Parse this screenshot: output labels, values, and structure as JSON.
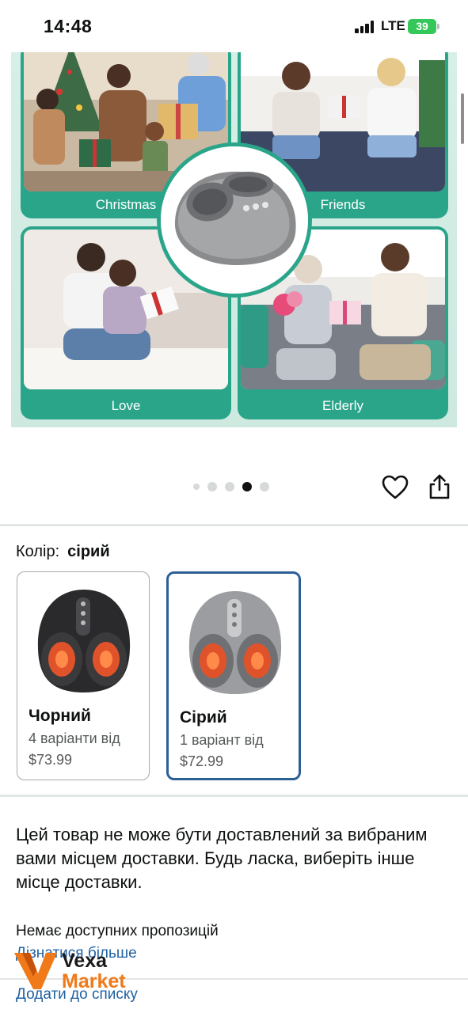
{
  "status_bar": {
    "time": "14:48",
    "network": "LTE",
    "battery": "39"
  },
  "gallery": {
    "tiles": [
      {
        "label": "Christmas"
      },
      {
        "label": "Friends"
      },
      {
        "label": "Love"
      },
      {
        "label": "Elderly"
      }
    ],
    "pagination": {
      "count": 5,
      "active_index": 3
    }
  },
  "actions": {
    "favorite_icon": "heart-icon",
    "share_icon": "share-icon"
  },
  "color_selector": {
    "label": "Колір:",
    "selected_value": "сірий",
    "options": [
      {
        "name": "Чорний",
        "variants": "4 варіанти від",
        "price": "$73.99",
        "selected": false
      },
      {
        "name": "Сірий",
        "variants": "1 варіант від",
        "price": "$72.99",
        "selected": true
      }
    ]
  },
  "delivery": {
    "message": "Цей товар не може бути доставлений за вибраним вами місцем доставки. Будь ласка, виберіть інше місце доставки.",
    "no_offers": "Немає доступних пропозицій",
    "learn_more": "Дізнатися більше",
    "add_to_list": "Додати до списку"
  },
  "watermark": {
    "line1": "Vexa",
    "line2": "Market"
  },
  "colors": {
    "accent_teal": "#2aa58a",
    "link_blue": "#2162a1",
    "selected_border": "#2c5f96",
    "brand_orange": "#f07a1a"
  }
}
